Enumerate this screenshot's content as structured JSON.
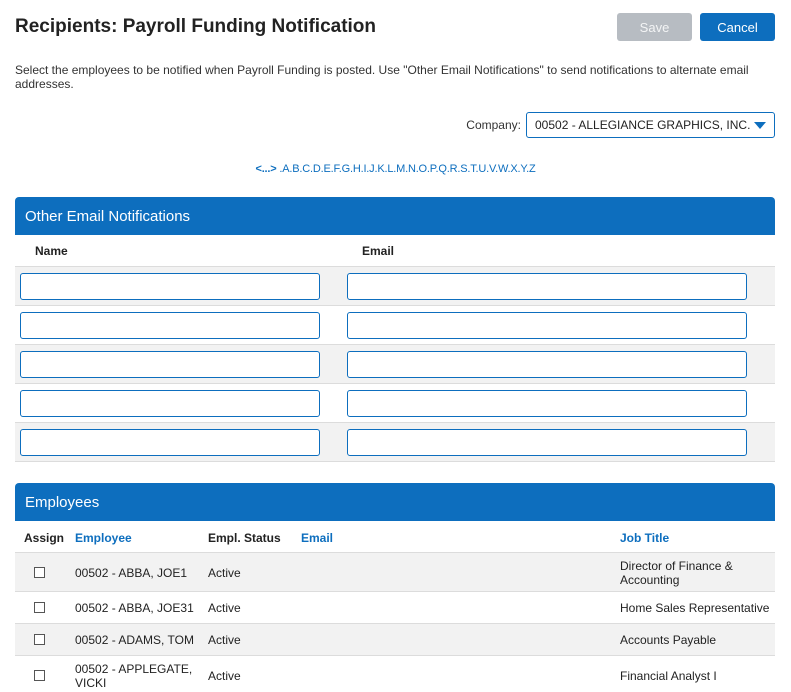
{
  "header": {
    "title": "Recipients: Payroll Funding Notification",
    "save_label": "Save",
    "cancel_label": "Cancel"
  },
  "intro": "Select the employees to be notified when Payroll Funding is posted. Use \"Other Email Notifications\" to send notifications to alternate email addresses.",
  "company": {
    "label": "Company:",
    "selected": "00502 - ALLEGIANCE GRAPHICS, INC."
  },
  "alpha_nav": {
    "range": "<...>",
    "letters": [
      "A",
      "B",
      "C",
      "D",
      "E",
      "F",
      "G",
      "H",
      "I",
      "J",
      "K",
      "L",
      "M",
      "N",
      "O",
      "P",
      "Q",
      "R",
      "S",
      "T",
      "U",
      "V",
      "W",
      "X",
      "Y",
      "Z"
    ]
  },
  "other_email": {
    "title": "Other Email Notifications",
    "col_name": "Name",
    "col_email": "Email"
  },
  "employees": {
    "title": "Employees",
    "col_assign": "Assign",
    "col_employee": "Employee",
    "col_status": "Empl. Status",
    "col_email": "Email",
    "col_job": "Job Title",
    "rows": [
      {
        "employee": "00502 - ABBA, JOE1",
        "status": "Active",
        "email": "",
        "job": "Director of Finance & Accounting"
      },
      {
        "employee": "00502 - ABBA, JOE31",
        "status": "Active",
        "email": "",
        "job": "Home Sales Representative"
      },
      {
        "employee": "00502 - ADAMS, TOM",
        "status": "Active",
        "email": "",
        "job": "Accounts Payable"
      },
      {
        "employee": "00502 - APPLEGATE, VICKI",
        "status": "Active",
        "email": "",
        "job": "Financial Analyst I"
      }
    ]
  },
  "colors": {
    "accent": "#0d6ebe",
    "disabled": "#b7bcc2",
    "row_shade": "#f2f2f2"
  }
}
